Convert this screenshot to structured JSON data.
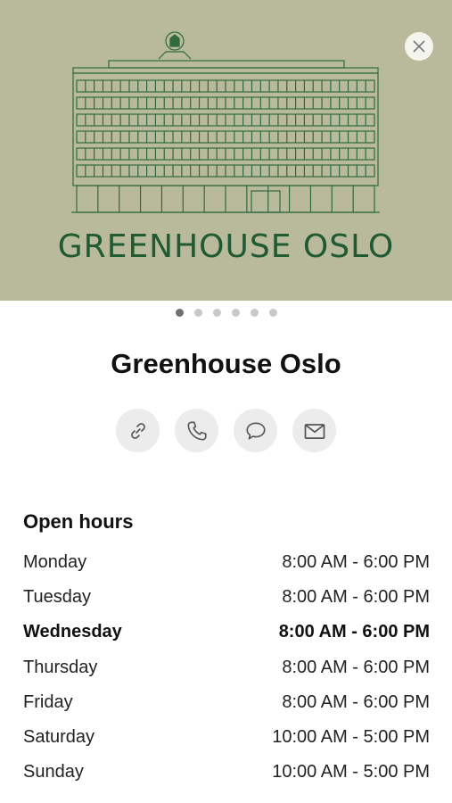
{
  "hero": {
    "logo_text": "GREENHOUSE OSLO",
    "background_color": "#b9ba9b",
    "logo_color": "#1f5a32",
    "close_icon": "close-icon",
    "page_count": 6,
    "active_page": 1
  },
  "place": {
    "name": "Greenhouse Oslo"
  },
  "actions": [
    {
      "name": "website",
      "icon": "link-icon"
    },
    {
      "name": "call",
      "icon": "phone-icon"
    },
    {
      "name": "message",
      "icon": "chat-bubble-icon"
    },
    {
      "name": "email",
      "icon": "envelope-icon"
    }
  ],
  "open_hours": {
    "title": "Open hours",
    "days": [
      {
        "day": "Monday",
        "hours": "8:00 AM - 6:00 PM"
      },
      {
        "day": "Tuesday",
        "hours": "8:00 AM - 6:00 PM"
      },
      {
        "day": "Wednesday",
        "hours": "8:00 AM - 6:00 PM",
        "today": true
      },
      {
        "day": "Thursday",
        "hours": "8:00 AM - 6:00 PM"
      },
      {
        "day": "Friday",
        "hours": "8:00 AM - 6:00 PM"
      },
      {
        "day": "Saturday",
        "hours": "10:00 AM - 5:00 PM"
      },
      {
        "day": "Sunday",
        "hours": "10:00 AM - 5:00 PM"
      }
    ]
  }
}
